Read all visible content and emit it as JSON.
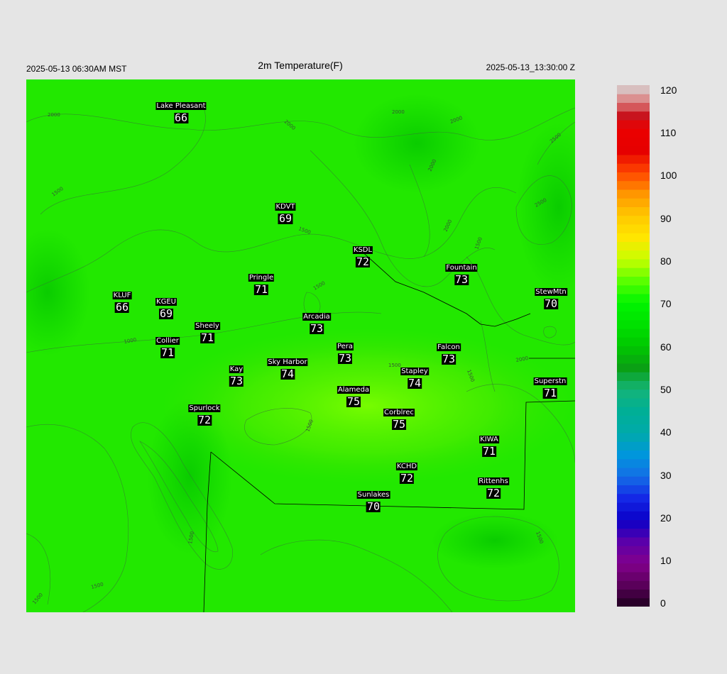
{
  "header": {
    "local_time": "2025-05-13 06:30AM MST",
    "title": "2m Temperature(F)",
    "utc_time": "2025-05-13_13:30:00 Z"
  },
  "colorbar": {
    "ticks": [
      "120",
      "110",
      "100",
      "90",
      "80",
      "70",
      "60",
      "50",
      "40",
      "30",
      "20",
      "10",
      "0"
    ],
    "range": [
      0,
      120
    ]
  },
  "contour_labels": [
    "2000",
    "2000",
    "2000",
    "2000",
    "2000",
    "2500",
    "2000",
    "2500",
    "1500",
    "1500",
    "1500",
    "1500",
    "1500",
    "1500",
    "1000",
    "1500",
    "1500",
    "1500",
    "1500",
    "2000",
    "1500"
  ],
  "stations": [
    {
      "name": "Lake Pleasant",
      "value": "66"
    },
    {
      "name": "KDVT",
      "value": "69"
    },
    {
      "name": "KSDL",
      "value": "72"
    },
    {
      "name": "Fountain",
      "value": "73"
    },
    {
      "name": "Pringle",
      "value": "71"
    },
    {
      "name": "KLUF",
      "value": "66"
    },
    {
      "name": "KGEU",
      "value": "69"
    },
    {
      "name": "StewMtn",
      "value": "70"
    },
    {
      "name": "Arcadia",
      "value": "73"
    },
    {
      "name": "Sheely",
      "value": "71"
    },
    {
      "name": "Collier",
      "value": "71"
    },
    {
      "name": "Pera",
      "value": "73"
    },
    {
      "name": "Falcon",
      "value": "73"
    },
    {
      "name": "Kay",
      "value": "73"
    },
    {
      "name": "Sky Harbor",
      "value": "74"
    },
    {
      "name": "Stapley",
      "value": "74"
    },
    {
      "name": "Superstn",
      "value": "71"
    },
    {
      "name": "Alameda",
      "value": "75"
    },
    {
      "name": "Spurlock",
      "value": "72"
    },
    {
      "name": "Corblrec",
      "value": "75"
    },
    {
      "name": "KIWA",
      "value": "71"
    },
    {
      "name": "KCHD",
      "value": "72"
    },
    {
      "name": "Rittenhs",
      "value": "72"
    },
    {
      "name": "Sunlakes",
      "value": "70"
    }
  ]
}
